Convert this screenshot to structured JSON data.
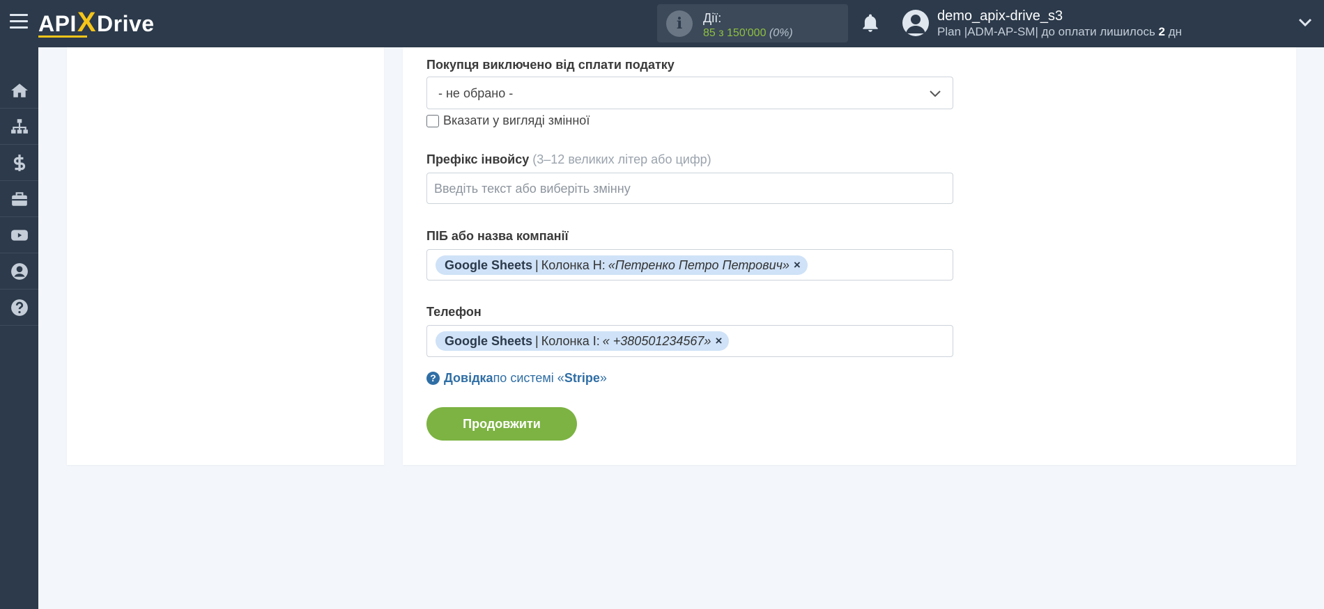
{
  "header": {
    "logo_prefix": "API",
    "logo_x": "X",
    "logo_suffix": "Drive",
    "actions_label": "Дії:",
    "actions_count": "85 з 150'000",
    "actions_percent": "(0%)",
    "user_name": "demo_apix-drive_s3",
    "plan_text": "Plan |ADM-AP-SM| до оплати лишилось ",
    "plan_days": "2",
    "plan_days_suffix": " дн"
  },
  "sidebar": {
    "items": [
      {
        "icon": "home-icon"
      },
      {
        "icon": "sitemap-icon"
      },
      {
        "icon": "dollar-icon"
      },
      {
        "icon": "briefcase-icon"
      },
      {
        "icon": "youtube-icon"
      },
      {
        "icon": "user-circle-icon"
      },
      {
        "icon": "question-icon"
      }
    ]
  },
  "form": {
    "tax_exempt": {
      "label": "Покупця виключено від сплати податку",
      "value": "- не обрано -",
      "checkbox_label": "Вказати у вигляді змінної"
    },
    "invoice_prefix": {
      "label": "Префікс інвойсу",
      "hint": "(3–12 великих літер або цифр)",
      "placeholder": "Введіть текст або виберіть змінну"
    },
    "company_name": {
      "label": "ПІБ або назва компанії",
      "tag_source": "Google Sheets",
      "tag_sep": "|",
      "tag_column": "Колонка H:",
      "tag_value": "«Петренко Петро Петрович»",
      "tag_remove": "×"
    },
    "phone": {
      "label": "Телефон",
      "tag_source": "Google Sheets",
      "tag_sep": "|",
      "tag_column": "Колонка I:",
      "tag_value": "« +380501234567»",
      "tag_remove": "×"
    },
    "help": {
      "link": "Довідка",
      "text": " по системі «",
      "system": "Stripe",
      "close": "»"
    },
    "continue_label": "Продовжити"
  },
  "colors": {
    "topbar": "#2c3a4b",
    "accent_green": "#7cb342",
    "tag_bg": "#cfe2f7",
    "link": "#2f6ea5"
  }
}
